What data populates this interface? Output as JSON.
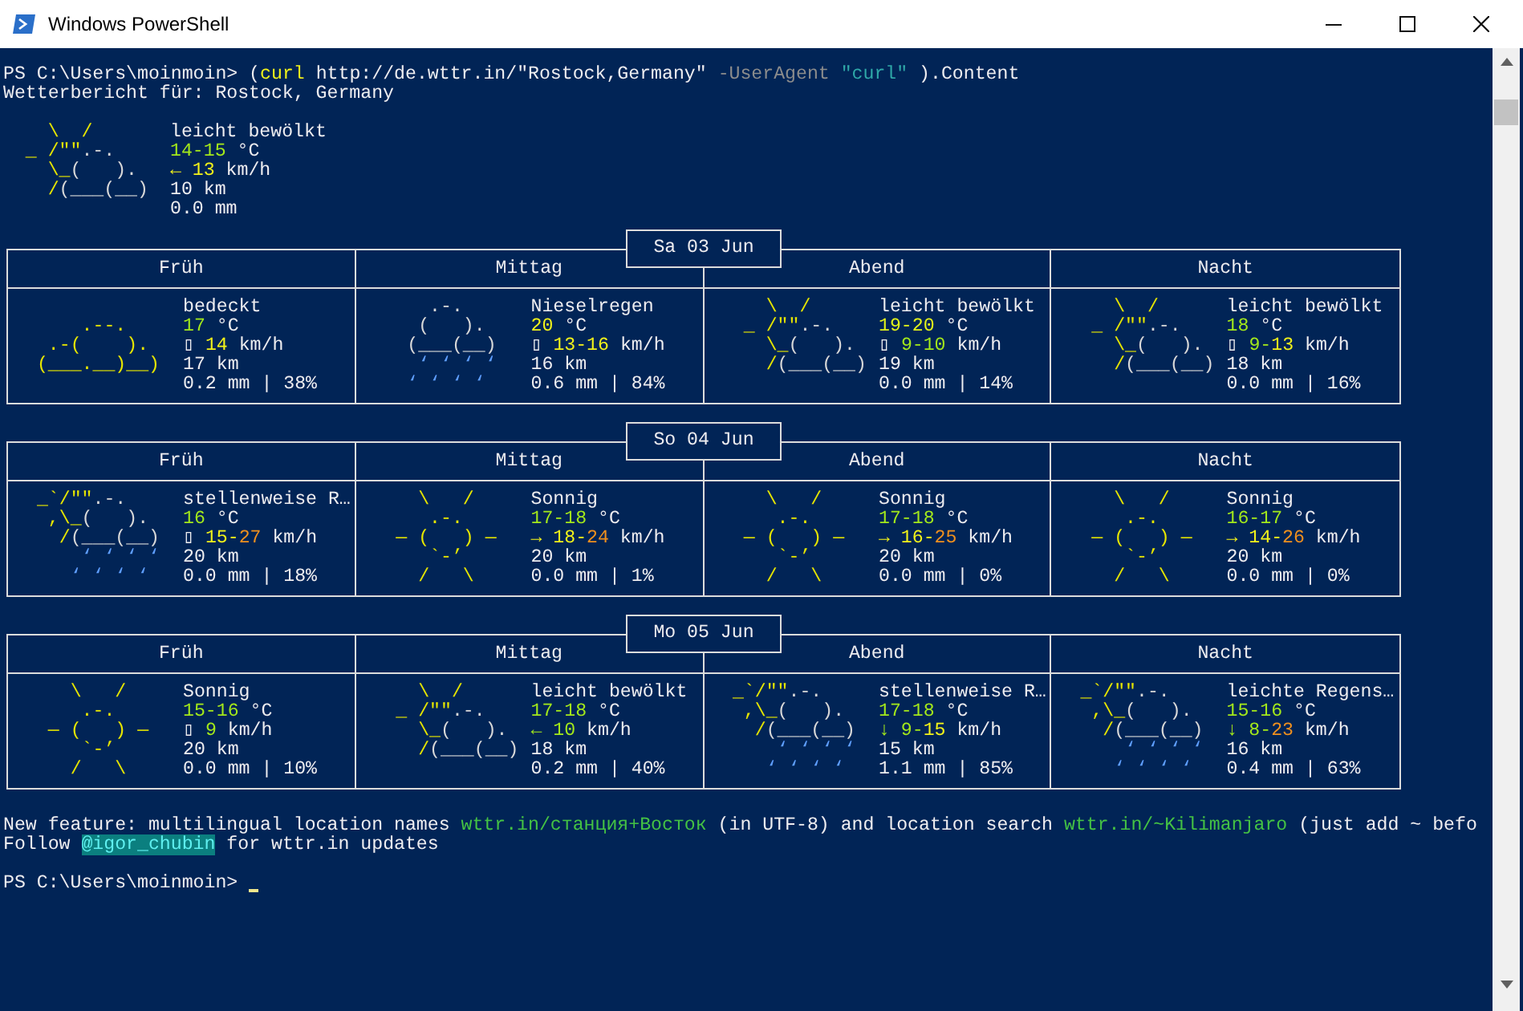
{
  "window": {
    "title": "Windows PowerShell"
  },
  "command_line": [
    {
      "text": "PS C:\\Users\\moinmoin> ("
    },
    {
      "text": "curl",
      "color": "#f2f21a"
    },
    {
      "text": " http://de.wttr.in/\"Rostock,Germany\" "
    },
    {
      "text": "-UserAgent ",
      "color": "#8c8c8c"
    },
    {
      "text": "\"curl\"",
      "color": "#2fa8a8"
    },
    {
      "text": " ).Content"
    }
  ],
  "report_title": "Wetterbericht für: Rostock, Germany",
  "current": {
    "art": {
      "kind": "partly_cloudy",
      "lines": [
        [
          {
            "text": "    \\  /",
            "color": "#e6e600"
          }
        ],
        [
          {
            "text": "  _ /\"\"",
            "color": "#e6e600"
          },
          {
            "text": ".-.",
            "color": "#d8d8d8"
          }
        ],
        [
          {
            "text": "    \\_",
            "color": "#e6e600"
          },
          {
            "text": "(   ).",
            "color": "#d8d8d8"
          }
        ],
        [
          {
            "text": "    /",
            "color": "#e6e600"
          },
          {
            "text": "(___(__)",
            "color": "#d8d8d8"
          }
        ]
      ]
    },
    "description": "leicht bewölkt",
    "temperature": [
      {
        "text": "14-15",
        "color": "#a3e81b"
      },
      {
        "text": " °C"
      }
    ],
    "wind": [
      {
        "text": "← 13",
        "color": "#f2f21a"
      },
      {
        "text": " km/h"
      }
    ],
    "visibility": "10 km",
    "precipitation": "0.0 mm"
  },
  "days": [
    {
      "date": "Sa 03 Jun",
      "periods": [
        {
          "label": "Früh",
          "art": {
            "kind": "cloudy",
            "lines": [
              [
                {
                  "text": "     .--.",
                  "color": "#e6e600"
                }
              ],
              [
                {
                  "text": "  .-(    ).",
                  "color": "#e6e600"
                }
              ],
              [
                {
                  "text": " (___.__)__)",
                  "color": "#e6e600"
                }
              ]
            ]
          },
          "description": "bedeckt",
          "temperature": [
            {
              "text": "17",
              "color": "#a3e81b"
            },
            {
              "text": " °C"
            }
          ],
          "wind": [
            {
              "text": "▯ "
            },
            {
              "text": "14",
              "color": "#f2f21a"
            },
            {
              "text": " km/h"
            }
          ],
          "visibility": "17 km",
          "precipitation": "0.2 mm | 38%"
        },
        {
          "label": "Mittag",
          "art": {
            "kind": "drizzle",
            "lines": [
              [
                {
                  "text": "     .-.",
                  "color": "#d8d8d8"
                }
              ],
              [
                {
                  "text": "    (   ).",
                  "color": "#d8d8d8"
                }
              ],
              [
                {
                  "text": "   (___(__)",
                  "color": "#d8d8d8"
                }
              ],
              [
                {
                  "text": "    ‘ ‘ ‘ ‘",
                  "color": "#5f9fff"
                }
              ],
              [
                {
                  "text": "   ‘ ‘ ‘ ‘",
                  "color": "#5f9fff"
                }
              ]
            ]
          },
          "description": "Nieselregen",
          "temperature": [
            {
              "text": "20",
              "color": "#f2f21a"
            },
            {
              "text": " °C"
            }
          ],
          "wind": [
            {
              "text": "▯ "
            },
            {
              "text": "13-16",
              "color": "#f2f21a"
            },
            {
              "text": " km/h"
            }
          ],
          "visibility": "16 km",
          "precipitation": "0.6 mm | 84%"
        },
        {
          "label": "Abend",
          "art": {
            "kind": "partly_cloudy",
            "lines": [
              [
                {
                  "text": "    \\  /",
                  "color": "#e6e600"
                }
              ],
              [
                {
                  "text": "  _ /\"\"",
                  "color": "#e6e600"
                },
                {
                  "text": ".-.",
                  "color": "#d8d8d8"
                }
              ],
              [
                {
                  "text": "    \\_",
                  "color": "#e6e600"
                },
                {
                  "text": "(   ).",
                  "color": "#d8d8d8"
                }
              ],
              [
                {
                  "text": "    /",
                  "color": "#e6e600"
                },
                {
                  "text": "(___(__)",
                  "color": "#d8d8d8"
                }
              ]
            ]
          },
          "description": "leicht bewölkt",
          "temperature": [
            {
              "text": "19-20",
              "color": "#e2f21a"
            },
            {
              "text": " °C"
            }
          ],
          "wind": [
            {
              "text": "▯ "
            },
            {
              "text": "9-10",
              "color": "#a3e81b"
            },
            {
              "text": " km/h"
            }
          ],
          "visibility": "19 km",
          "precipitation": "0.0 mm | 14%"
        },
        {
          "label": "Nacht",
          "art": {
            "kind": "partly_cloudy",
            "lines": [
              [
                {
                  "text": "    \\  /",
                  "color": "#e6e600"
                }
              ],
              [
                {
                  "text": "  _ /\"\"",
                  "color": "#e6e600"
                },
                {
                  "text": ".-.",
                  "color": "#d8d8d8"
                }
              ],
              [
                {
                  "text": "    \\_",
                  "color": "#e6e600"
                },
                {
                  "text": "(   ).",
                  "color": "#d8d8d8"
                }
              ],
              [
                {
                  "text": "    /",
                  "color": "#e6e600"
                },
                {
                  "text": "(___(__)",
                  "color": "#d8d8d8"
                }
              ]
            ]
          },
          "description": "leicht bewölkt",
          "temperature": [
            {
              "text": "18",
              "color": "#a3e81b"
            },
            {
              "text": " °C"
            }
          ],
          "wind": [
            {
              "text": "▯ "
            },
            {
              "text": "9-",
              "color": "#a3e81b"
            },
            {
              "text": "13",
              "color": "#f2f21a"
            },
            {
              "text": " km/h"
            }
          ],
          "visibility": "18 km",
          "precipitation": "0.0 mm | 16%"
        }
      ]
    },
    {
      "date": "So 04 Jun",
      "periods": [
        {
          "label": "Früh",
          "art": {
            "kind": "showers",
            "lines": [
              [
                {
                  "text": " _`/\"\"",
                  "color": "#e6e600"
                },
                {
                  "text": ".-.",
                  "color": "#d8d8d8"
                }
              ],
              [
                {
                  "text": "  ,\\_",
                  "color": "#e6e600"
                },
                {
                  "text": "(   ).",
                  "color": "#d8d8d8"
                }
              ],
              [
                {
                  "text": "   /",
                  "color": "#e6e600"
                },
                {
                  "text": "(___(__)",
                  "color": "#d8d8d8"
                }
              ],
              [
                {
                  "text": "     ‘ ‘ ‘ ‘",
                  "color": "#5f9fff"
                }
              ],
              [
                {
                  "text": "    ‘ ‘ ‘ ‘",
                  "color": "#5f9fff"
                }
              ]
            ]
          },
          "description": "stellenweise R…",
          "temperature": [
            {
              "text": "16",
              "color": "#a3e81b"
            },
            {
              "text": " °C"
            }
          ],
          "wind": [
            {
              "text": "▯ "
            },
            {
              "text": "15-",
              "color": "#f2f21a"
            },
            {
              "text": "27",
              "color": "#f0901e"
            },
            {
              "text": " km/h"
            }
          ],
          "visibility": "20 km",
          "precipitation": "0.0 mm | 18%"
        },
        {
          "label": "Mittag",
          "art": {
            "kind": "sunny",
            "lines": [
              [
                {
                  "text": "    \\   /",
                  "color": "#e6e600"
                }
              ],
              [
                {
                  "text": "     .-.",
                  "color": "#e6e600"
                }
              ],
              [
                {
                  "text": "  ― (   ) ―",
                  "color": "#e6e600"
                }
              ],
              [
                {
                  "text": "     `-’",
                  "color": "#e6e600"
                }
              ],
              [
                {
                  "text": "    /   \\",
                  "color": "#e6e600"
                }
              ]
            ]
          },
          "description": "Sonnig",
          "temperature": [
            {
              "text": "17-18",
              "color": "#a3e81b"
            },
            {
              "text": " °C"
            }
          ],
          "wind": [
            {
              "text": "→ 18-",
              "color": "#f2f21a"
            },
            {
              "text": "24",
              "color": "#f0901e"
            },
            {
              "text": " km/h"
            }
          ],
          "visibility": "20 km",
          "precipitation": "0.0 mm | 1%"
        },
        {
          "label": "Abend",
          "art": {
            "kind": "sunny",
            "lines": [
              [
                {
                  "text": "    \\   /",
                  "color": "#e6e600"
                }
              ],
              [
                {
                  "text": "     .-.",
                  "color": "#e6e600"
                }
              ],
              [
                {
                  "text": "  ― (   ) ―",
                  "color": "#e6e600"
                }
              ],
              [
                {
                  "text": "     `-’",
                  "color": "#e6e600"
                }
              ],
              [
                {
                  "text": "    /   \\",
                  "color": "#e6e600"
                }
              ]
            ]
          },
          "description": "Sonnig",
          "temperature": [
            {
              "text": "17-18",
              "color": "#a3e81b"
            },
            {
              "text": " °C"
            }
          ],
          "wind": [
            {
              "text": "→ 16-",
              "color": "#f2f21a"
            },
            {
              "text": "25",
              "color": "#f0901e"
            },
            {
              "text": " km/h"
            }
          ],
          "visibility": "20 km",
          "precipitation": "0.0 mm | 0%"
        },
        {
          "label": "Nacht",
          "art": {
            "kind": "sunny",
            "lines": [
              [
                {
                  "text": "    \\   /",
                  "color": "#e6e600"
                }
              ],
              [
                {
                  "text": "     .-.",
                  "color": "#e6e600"
                }
              ],
              [
                {
                  "text": "  ― (   ) ―",
                  "color": "#e6e600"
                }
              ],
              [
                {
                  "text": "     `-’",
                  "color": "#e6e600"
                }
              ],
              [
                {
                  "text": "    /   \\",
                  "color": "#e6e600"
                }
              ]
            ]
          },
          "description": "Sonnig",
          "temperature": [
            {
              "text": "16-17",
              "color": "#a3e81b"
            },
            {
              "text": " °C"
            }
          ],
          "wind": [
            {
              "text": "→ 14-",
              "color": "#f2f21a"
            },
            {
              "text": "26",
              "color": "#f0901e"
            },
            {
              "text": " km/h"
            }
          ],
          "visibility": "20 km",
          "precipitation": "0.0 mm | 0%"
        }
      ]
    },
    {
      "date": "Mo 05 Jun",
      "periods": [
        {
          "label": "Früh",
          "art": {
            "kind": "sunny",
            "lines": [
              [
                {
                  "text": "    \\   /",
                  "color": "#e6e600"
                }
              ],
              [
                {
                  "text": "     .-.",
                  "color": "#e6e600"
                }
              ],
              [
                {
                  "text": "  ― (   ) ―",
                  "color": "#e6e600"
                }
              ],
              [
                {
                  "text": "     `-’",
                  "color": "#e6e600"
                }
              ],
              [
                {
                  "text": "    /   \\",
                  "color": "#e6e600"
                }
              ]
            ]
          },
          "description": "Sonnig",
          "temperature": [
            {
              "text": "15-16",
              "color": "#a3e81b"
            },
            {
              "text": " °C"
            }
          ],
          "wind": [
            {
              "text": "▯ "
            },
            {
              "text": "9",
              "color": "#a3e81b"
            },
            {
              "text": " km/h"
            }
          ],
          "visibility": "20 km",
          "precipitation": "0.0 mm | 10%"
        },
        {
          "label": "Mittag",
          "art": {
            "kind": "partly_cloudy",
            "lines": [
              [
                {
                  "text": "    \\  /",
                  "color": "#e6e600"
                }
              ],
              [
                {
                  "text": "  _ /\"\"",
                  "color": "#e6e600"
                },
                {
                  "text": ".-.",
                  "color": "#d8d8d8"
                }
              ],
              [
                {
                  "text": "    \\_",
                  "color": "#e6e600"
                },
                {
                  "text": "(   ).",
                  "color": "#d8d8d8"
                }
              ],
              [
                {
                  "text": "    /",
                  "color": "#e6e600"
                },
                {
                  "text": "(___(__)",
                  "color": "#d8d8d8"
                }
              ]
            ]
          },
          "description": "leicht bewölkt",
          "temperature": [
            {
              "text": "17-18",
              "color": "#a3e81b"
            },
            {
              "text": " °C"
            }
          ],
          "wind": [
            {
              "text": "← 10",
              "color": "#a3e81b"
            },
            {
              "text": " km/h"
            }
          ],
          "visibility": "18 km",
          "precipitation": "0.2 mm | 40%"
        },
        {
          "label": "Abend",
          "art": {
            "kind": "showers",
            "lines": [
              [
                {
                  "text": " _`/\"\"",
                  "color": "#e6e600"
                },
                {
                  "text": ".-.",
                  "color": "#d8d8d8"
                }
              ],
              [
                {
                  "text": "  ,\\_",
                  "color": "#e6e600"
                },
                {
                  "text": "(   ).",
                  "color": "#d8d8d8"
                }
              ],
              [
                {
                  "text": "   /",
                  "color": "#e6e600"
                },
                {
                  "text": "(___(__)",
                  "color": "#d8d8d8"
                }
              ],
              [
                {
                  "text": "     ‘ ‘ ‘ ‘",
                  "color": "#5f9fff"
                }
              ],
              [
                {
                  "text": "    ‘ ‘ ‘ ‘",
                  "color": "#5f9fff"
                }
              ]
            ]
          },
          "description": "stellenweise R…",
          "temperature": [
            {
              "text": "17-18",
              "color": "#a3e81b"
            },
            {
              "text": " °C"
            }
          ],
          "wind": [
            {
              "text": "↓ 9-",
              "color": "#a3e81b"
            },
            {
              "text": "15",
              "color": "#f2f21a"
            },
            {
              "text": " km/h"
            }
          ],
          "visibility": "15 km",
          "precipitation": "1.1 mm | 85%"
        },
        {
          "label": "Nacht",
          "art": {
            "kind": "showers",
            "lines": [
              [
                {
                  "text": " _`/\"\"",
                  "color": "#e6e600"
                },
                {
                  "text": ".-.",
                  "color": "#d8d8d8"
                }
              ],
              [
                {
                  "text": "  ,\\_",
                  "color": "#e6e600"
                },
                {
                  "text": "(   ).",
                  "color": "#d8d8d8"
                }
              ],
              [
                {
                  "text": "   /",
                  "color": "#e6e600"
                },
                {
                  "text": "(___(__)",
                  "color": "#d8d8d8"
                }
              ],
              [
                {
                  "text": "     ‘ ‘ ‘ ‘",
                  "color": "#5f9fff"
                }
              ],
              [
                {
                  "text": "    ‘ ‘ ‘ ‘",
                  "color": "#5f9fff"
                }
              ]
            ]
          },
          "description": "leichte Regens…",
          "temperature": [
            {
              "text": "15-16",
              "color": "#a3e81b"
            },
            {
              "text": " °C"
            }
          ],
          "wind": [
            {
              "text": "↓ 8-",
              "color": "#a3e81b"
            },
            {
              "text": "23",
              "color": "#f0901e"
            },
            {
              "text": " km/h"
            }
          ],
          "visibility": "16 km",
          "precipitation": "0.4 mm | 63%"
        }
      ]
    }
  ],
  "footer_lines": [
    [
      {
        "text": "New feature: multilingual location names ",
        "highlighted": false
      },
      {
        "text": "wttr.in/станция+Восток",
        "color": "#44c244",
        "highlighted": false
      },
      {
        "text": " (in UTF-8) and location search ",
        "highlighted": false
      },
      {
        "text": "wttr.in/~Kilimanjaro",
        "color": "#44c244",
        "highlighted": false
      },
      {
        "text": " (just add ~ befo",
        "highlighted": false
      }
    ],
    [
      {
        "text": "Follow ",
        "highlighted": false
      },
      {
        "text": "@igor_chubin",
        "highlighted": true
      },
      {
        "text": " for wttr.in updates",
        "highlighted": false
      }
    ]
  ],
  "prompt": "PS C:\\Users\\moinmoin> "
}
